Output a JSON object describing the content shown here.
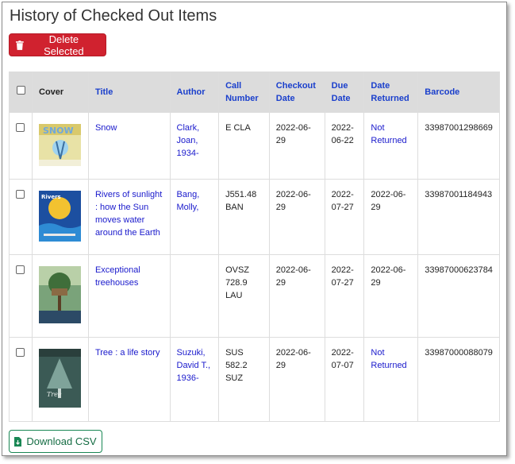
{
  "page": {
    "title": "History of Checked Out Items",
    "delete_label": "Delete Selected",
    "download_label": "Download CSV"
  },
  "table": {
    "headers": {
      "cover": "Cover",
      "title": "Title",
      "author": "Author",
      "call_number": "Call Number",
      "checkout_date": "Checkout Date",
      "due_date": "Due Date",
      "date_returned": "Date Returned",
      "barcode": "Barcode"
    },
    "rows": [
      {
        "title": "Snow",
        "author": "Clark, Joan, 1934-",
        "call_number": "E CLA",
        "checkout_date": "2022-06-29",
        "due_date": "2022-06-22",
        "date_returned": "Not Returned",
        "returned_is_link": true,
        "barcode": "33987001298669",
        "cover_icon": "snow-book-cover"
      },
      {
        "title": "Rivers of sunlight : how the Sun moves water around the Earth",
        "author": "Bang, Molly,",
        "call_number": "J551.48 BAN",
        "checkout_date": "2022-06-29",
        "due_date": "2022-07-27",
        "date_returned": "2022-06-29",
        "returned_is_link": false,
        "barcode": "33987001184943",
        "cover_icon": "rivers-book-cover"
      },
      {
        "title": "Exceptional treehouses",
        "author": "",
        "call_number": "OVSZ 728.9 LAU",
        "checkout_date": "2022-06-29",
        "due_date": "2022-07-27",
        "date_returned": "2022-06-29",
        "returned_is_link": false,
        "barcode": "33987000623784",
        "cover_icon": "treehouse-book-cover"
      },
      {
        "title": "Tree : a life story",
        "author": "Suzuki, David T., 1936-",
        "call_number": "SUS 582.2 SUZ",
        "checkout_date": "2022-06-29",
        "due_date": "2022-07-07",
        "date_returned": "Not Returned",
        "returned_is_link": true,
        "barcode": "33987000088079",
        "cover_icon": "tree-book-cover"
      }
    ]
  },
  "colors": {
    "danger": "#d0222f",
    "link": "#1a1acc",
    "success": "#198754",
    "header_bg": "#dcdcdc"
  }
}
